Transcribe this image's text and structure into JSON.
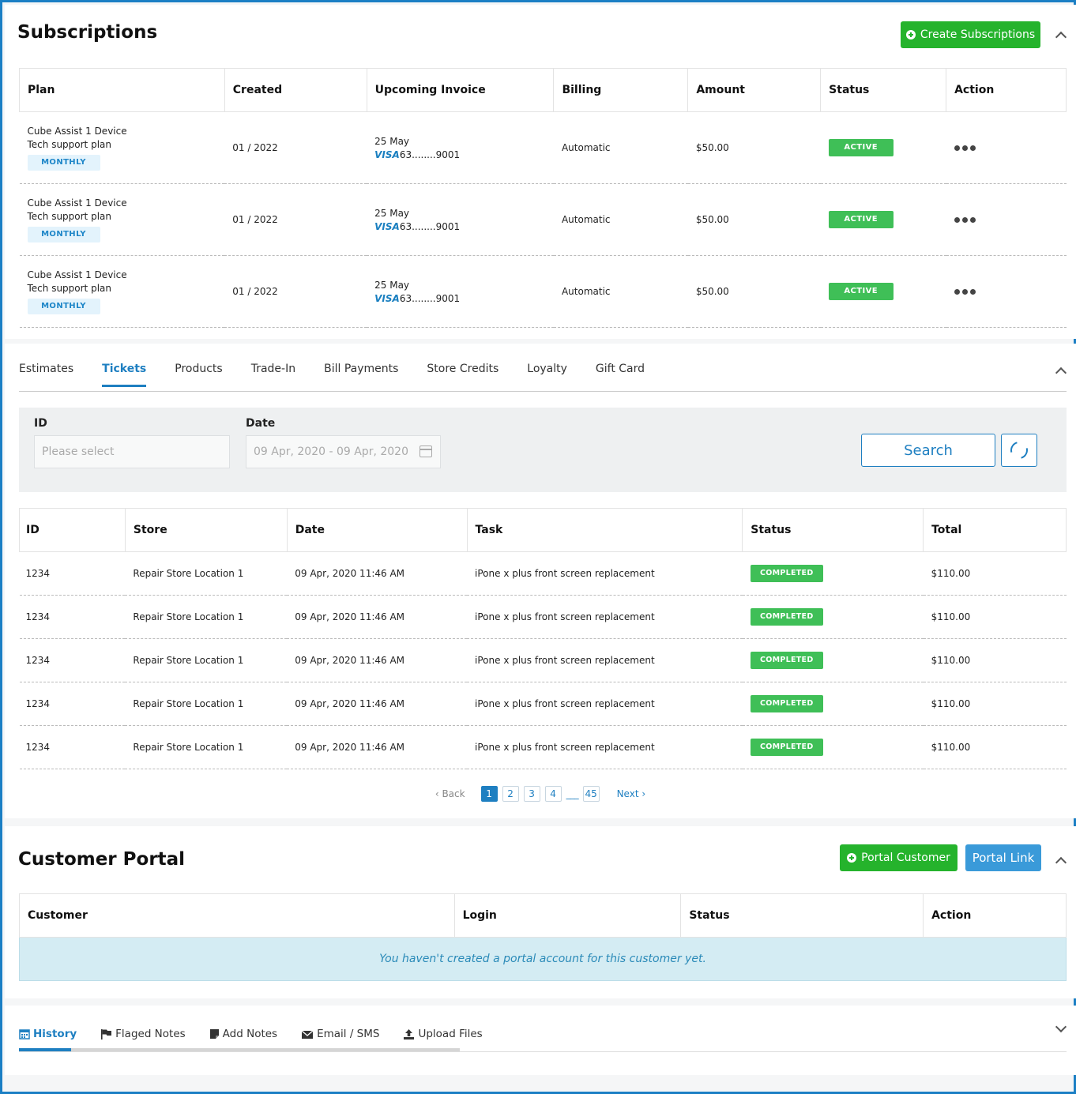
{
  "subscriptions": {
    "title": "Subscriptions",
    "create_label": "Create Subscriptions",
    "columns": [
      "Plan",
      "Created",
      "Upcoming Invoice",
      "Billing",
      "Amount",
      "Status",
      "Action"
    ],
    "rows": [
      {
        "plan_line1": "Cube Assist 1 Device",
        "plan_line2": "Tech support plan",
        "cycle": "MONTHLY",
        "created": "01 / 2022",
        "invoice_date": "25 May",
        "card_brand": "VISA",
        "card_number": "63........9001",
        "billing": "Automatic",
        "amount": "$50.00",
        "status": "ACTIVE"
      },
      {
        "plan_line1": "Cube Assist 1 Device",
        "plan_line2": "Tech support plan",
        "cycle": "MONTHLY",
        "created": "01 / 2022",
        "invoice_date": "25 May",
        "card_brand": "VISA",
        "card_number": "63........9001",
        "billing": "Automatic",
        "amount": "$50.00",
        "status": "ACTIVE"
      },
      {
        "plan_line1": "Cube Assist 1 Device",
        "plan_line2": "Tech support plan",
        "cycle": "MONTHLY",
        "created": "01 / 2022",
        "invoice_date": "25 May",
        "card_brand": "VISA",
        "card_number": "63........9001",
        "billing": "Automatic",
        "amount": "$50.00",
        "status": "ACTIVE"
      }
    ]
  },
  "records": {
    "tabs": [
      "Estimates",
      "Tickets",
      "Products",
      "Trade-In",
      "Bill Payments",
      "Store Credits",
      "Loyalty",
      "Gift Card"
    ],
    "active_tab": "Tickets",
    "filter": {
      "id_label": "ID",
      "id_placeholder": "Please select",
      "date_label": "Date",
      "date_value": "09 Apr, 2020 - 09 Apr, 2020",
      "search_label": "Search"
    },
    "columns": [
      "ID",
      "Store",
      "Date",
      "Task",
      "Status",
      "Total"
    ],
    "rows": [
      {
        "id": "1234",
        "store": "Repair Store Location 1",
        "date": "09 Apr, 2020 11:46 AM",
        "task": "iPone x plus  front screen replacement",
        "status": "COMPLETED",
        "total": "$110.00"
      },
      {
        "id": "1234",
        "store": "Repair Store Location 1",
        "date": "09 Apr, 2020 11:46 AM",
        "task": "iPone x plus  front screen replacement",
        "status": "COMPLETED",
        "total": "$110.00"
      },
      {
        "id": "1234",
        "store": "Repair Store Location 1",
        "date": "09 Apr, 2020 11:46 AM",
        "task": "iPone x plus  front screen replacement",
        "status": "COMPLETED",
        "total": "$110.00"
      },
      {
        "id": "1234",
        "store": "Repair Store Location 1",
        "date": "09 Apr, 2020 11:46 AM",
        "task": "iPone x plus  front screen replacement",
        "status": "COMPLETED",
        "total": "$110.00"
      },
      {
        "id": "1234",
        "store": "Repair Store Location 1",
        "date": "09 Apr, 2020 11:46 AM",
        "task": "iPone x plus  front screen replacement",
        "status": "COMPLETED",
        "total": "$110.00"
      }
    ],
    "pagination": {
      "back": "‹ Back",
      "pages": [
        "1",
        "2",
        "3",
        "4"
      ],
      "ellipsis": "___",
      "last": "45",
      "next": "Next  ›",
      "current": "1"
    }
  },
  "portal": {
    "title": "Customer Portal",
    "portal_customer_label": "Portal Customer",
    "portal_link_label": "Portal Link",
    "columns": [
      "Customer",
      "Login",
      "Status",
      "Action"
    ],
    "empty_message": "You haven't created a portal account for this customer yet."
  },
  "history": {
    "tabs": [
      "History",
      "Flaged Notes",
      "Add Notes",
      "Email / SMS",
      "Upload Files"
    ],
    "active_tab": "History",
    "tab_icons": [
      "calendar-icon",
      "flag-icon",
      "note-icon",
      "envelope-icon",
      "upload-icon"
    ]
  },
  "colors": {
    "accent_blue": "#1e7fc1",
    "success_green": "#25b32c",
    "badge_green": "#3fbf57",
    "frame_blue": "#1b7fc4"
  }
}
